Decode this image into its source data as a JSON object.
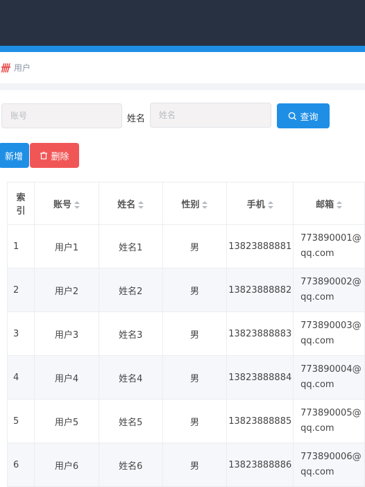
{
  "breadcrumb": {
    "label": "用户"
  },
  "search": {
    "account_placeholder": "账号",
    "name_label": "姓名",
    "name_placeholder": "姓名",
    "query_label": "查询"
  },
  "toolbar": {
    "add_label": "新增",
    "delete_label": "删除"
  },
  "table": {
    "headers": [
      "索\n引",
      "账号",
      "姓名",
      "性别",
      "手机",
      "邮箱"
    ],
    "rows": [
      [
        "1",
        "用户1",
        "姓名1",
        "男",
        "13823888881",
        "773890001@\nqq.com"
      ],
      [
        "2",
        "用户2",
        "姓名2",
        "男",
        "13823888882",
        "773890002@\nqq.com"
      ],
      [
        "3",
        "用户3",
        "姓名3",
        "男",
        "13823888883",
        "773890003@\nqq.com"
      ],
      [
        "4",
        "用户4",
        "姓名4",
        "男",
        "13823888884",
        "773890004@\nqq.com"
      ],
      [
        "5",
        "用户5",
        "姓名5",
        "男",
        "13823888885",
        "773890005@\nqq.com"
      ],
      [
        "6",
        "用户6",
        "姓名6",
        "男",
        "13823888886",
        "773890006@\nqq.com"
      ]
    ]
  },
  "colors": {
    "topbar": "#273142",
    "accent": "#1f8fe6",
    "danger": "#f15656"
  },
  "icons": {
    "breadcrumb": "app-logo-icon",
    "query": "search-icon",
    "delete": "trash-icon",
    "sort": "sort-caret-icon"
  }
}
